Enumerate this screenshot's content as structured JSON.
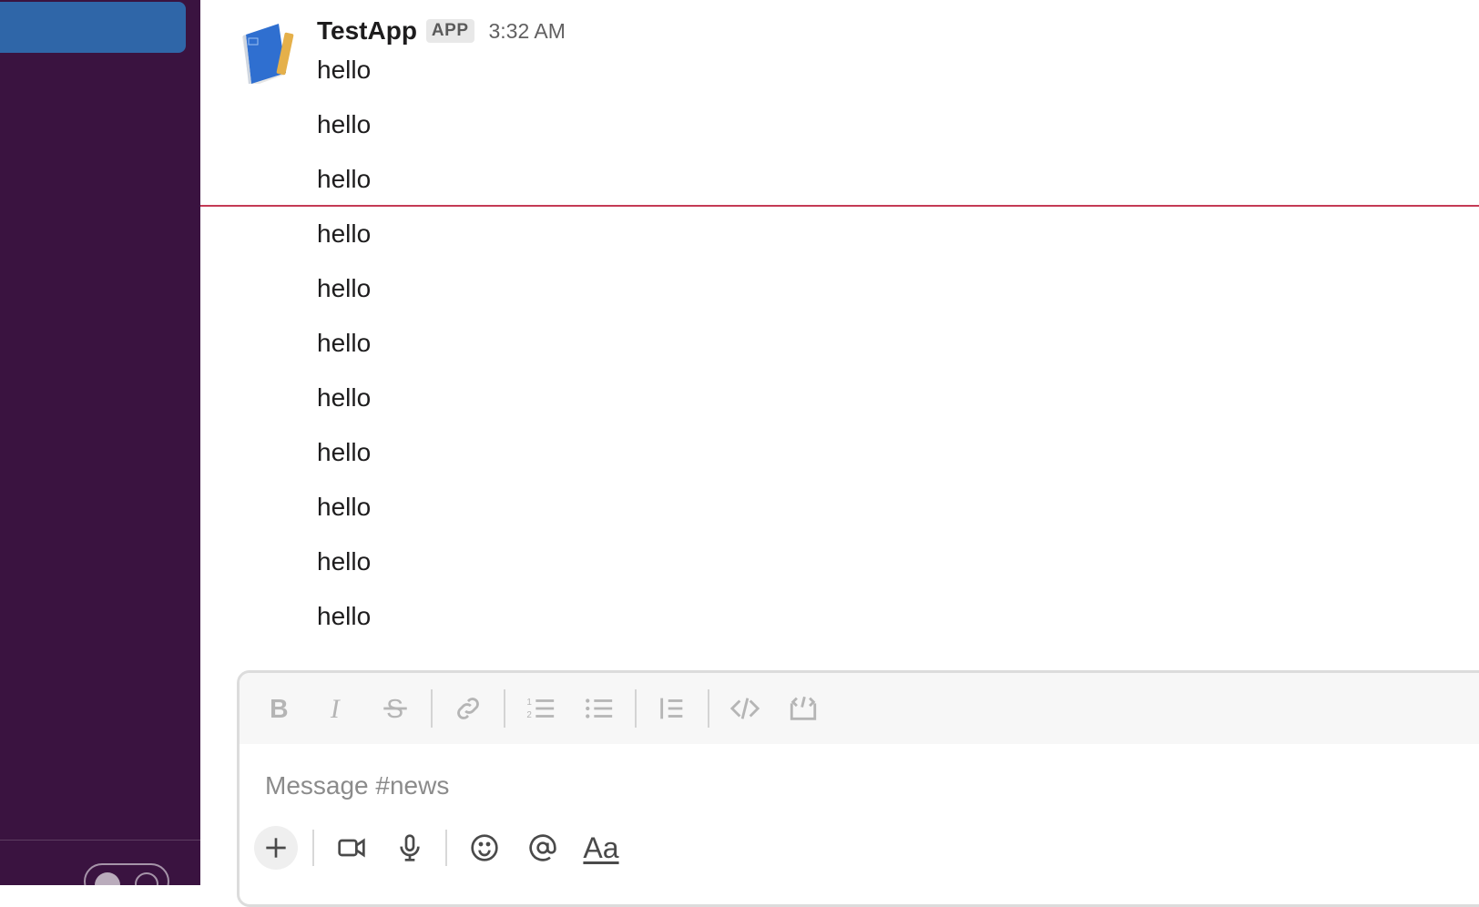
{
  "message": {
    "sender": "TestApp",
    "badge": "APP",
    "time": "3:32 AM",
    "lines": [
      "hello",
      "hello",
      "hello",
      "hello",
      "hello",
      "hello",
      "hello",
      "hello",
      "hello",
      "hello",
      "hello"
    ]
  },
  "composer": {
    "placeholder": "Message #news",
    "toolbar_icons": [
      "bold-icon",
      "italic-icon",
      "strikethrough-icon",
      "link-icon",
      "ordered-list-icon",
      "bulleted-list-icon",
      "blockquote-icon",
      "code-icon",
      "code-block-icon"
    ],
    "bottom_icons": [
      "plus-icon",
      "video-icon",
      "microphone-icon",
      "emoji-icon",
      "mention-icon",
      "formatting-icon"
    ],
    "formatting_label": "Aa"
  },
  "colors": {
    "sidebar_bg": "#3a1340",
    "sidebar_active": "#2f66a8",
    "new_messages_divider": "#c43a55"
  }
}
